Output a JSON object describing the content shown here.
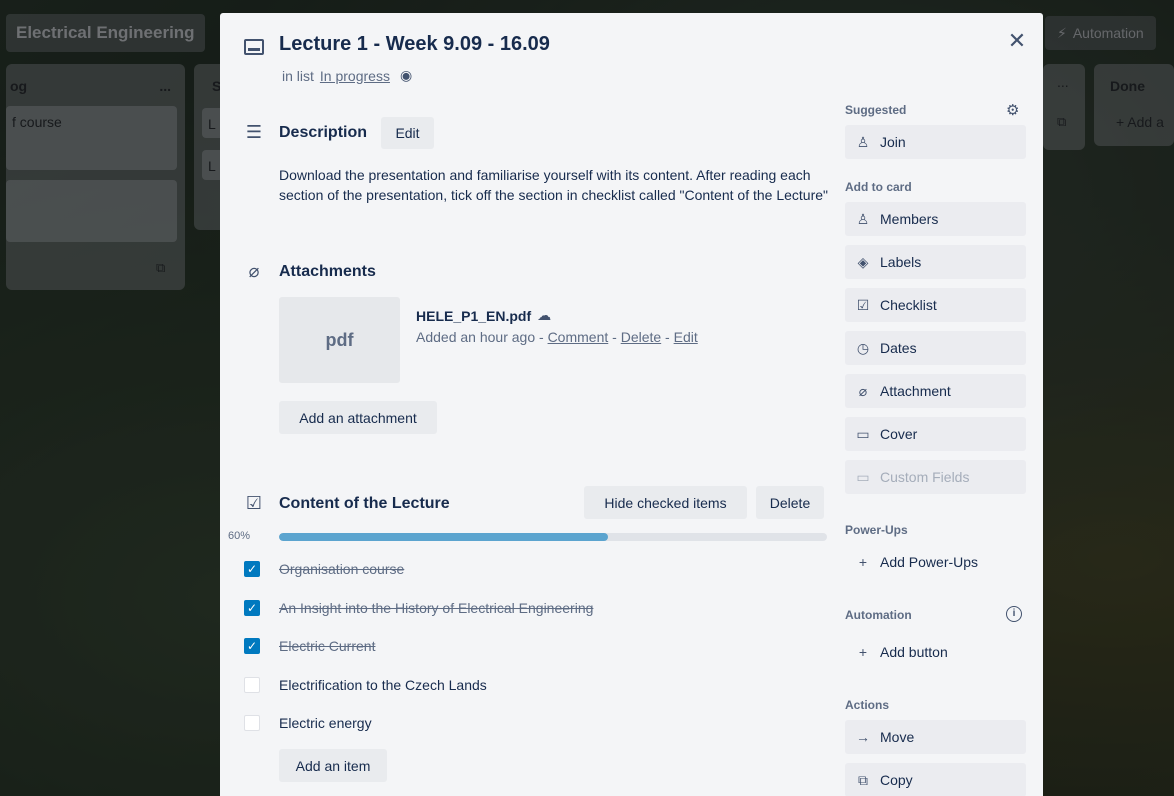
{
  "board": {
    "title": "Electrical Engineering",
    "automation_label": "Automation",
    "lists": [
      {
        "title": "og",
        "menu": "...",
        "card1": "f course",
        "footer_icon": "card-icon"
      },
      {
        "title": "S",
        "card1": "L",
        "card2": "L"
      },
      {
        "title": "",
        "menu": "..."
      },
      {
        "title": "Done",
        "add_card": "+ Add a"
      }
    ]
  },
  "card": {
    "title": "Lecture 1 - Week 9.09 - 16.09",
    "in_list_prefix": "in list",
    "list_name": "In progress",
    "close_icon": "close-icon"
  },
  "description": {
    "title": "Description",
    "edit_label": "Edit",
    "text": "Download the presentation and familiarise yourself with its content. After reading each section of the presentation, tick off the section in checklist called \"Content of the Lecture\""
  },
  "attachments": {
    "title": "Attachments",
    "thumb_label": "pdf",
    "file_name": "HELE_P1_EN.pdf",
    "added": "Added an hour ago",
    "comment": "Comment",
    "delete": "Delete",
    "edit": "Edit",
    "add_label": "Add an attachment"
  },
  "checklist": {
    "title": "Content of the Lecture",
    "hide_label": "Hide checked items",
    "delete_label": "Delete",
    "progress_text": "60%",
    "progress_value": 0.6,
    "items": [
      {
        "label": "Organisation course",
        "checked": true
      },
      {
        "label": "An Insight into the History of Electrical Engineering",
        "checked": true
      },
      {
        "label": "Electric Current",
        "checked": true
      },
      {
        "label": "Electrification to the Czech Lands",
        "checked": false
      },
      {
        "label": "Electric energy",
        "checked": false
      }
    ],
    "add_item_label": "Add an item"
  },
  "sidebar": {
    "suggested_heading": "Suggested",
    "join_label": "Join",
    "add_to_card_heading": "Add to card",
    "members_label": "Members",
    "labels_label": "Labels",
    "checklist_label": "Checklist",
    "dates_label": "Dates",
    "attachment_label": "Attachment",
    "cover_label": "Cover",
    "custom_fields_label": "Custom Fields",
    "powerups_heading": "Power-Ups",
    "add_powerups_label": "Add Power-Ups",
    "automation_heading": "Automation",
    "add_button_label": "Add button",
    "actions_heading": "Actions",
    "move_label": "Move",
    "copy_label": "Copy"
  },
  "colors": {
    "progress_fill": "#5ba4cf",
    "checkbox_checked": "#0079bf",
    "modal_bg": "#f4f5f7"
  }
}
